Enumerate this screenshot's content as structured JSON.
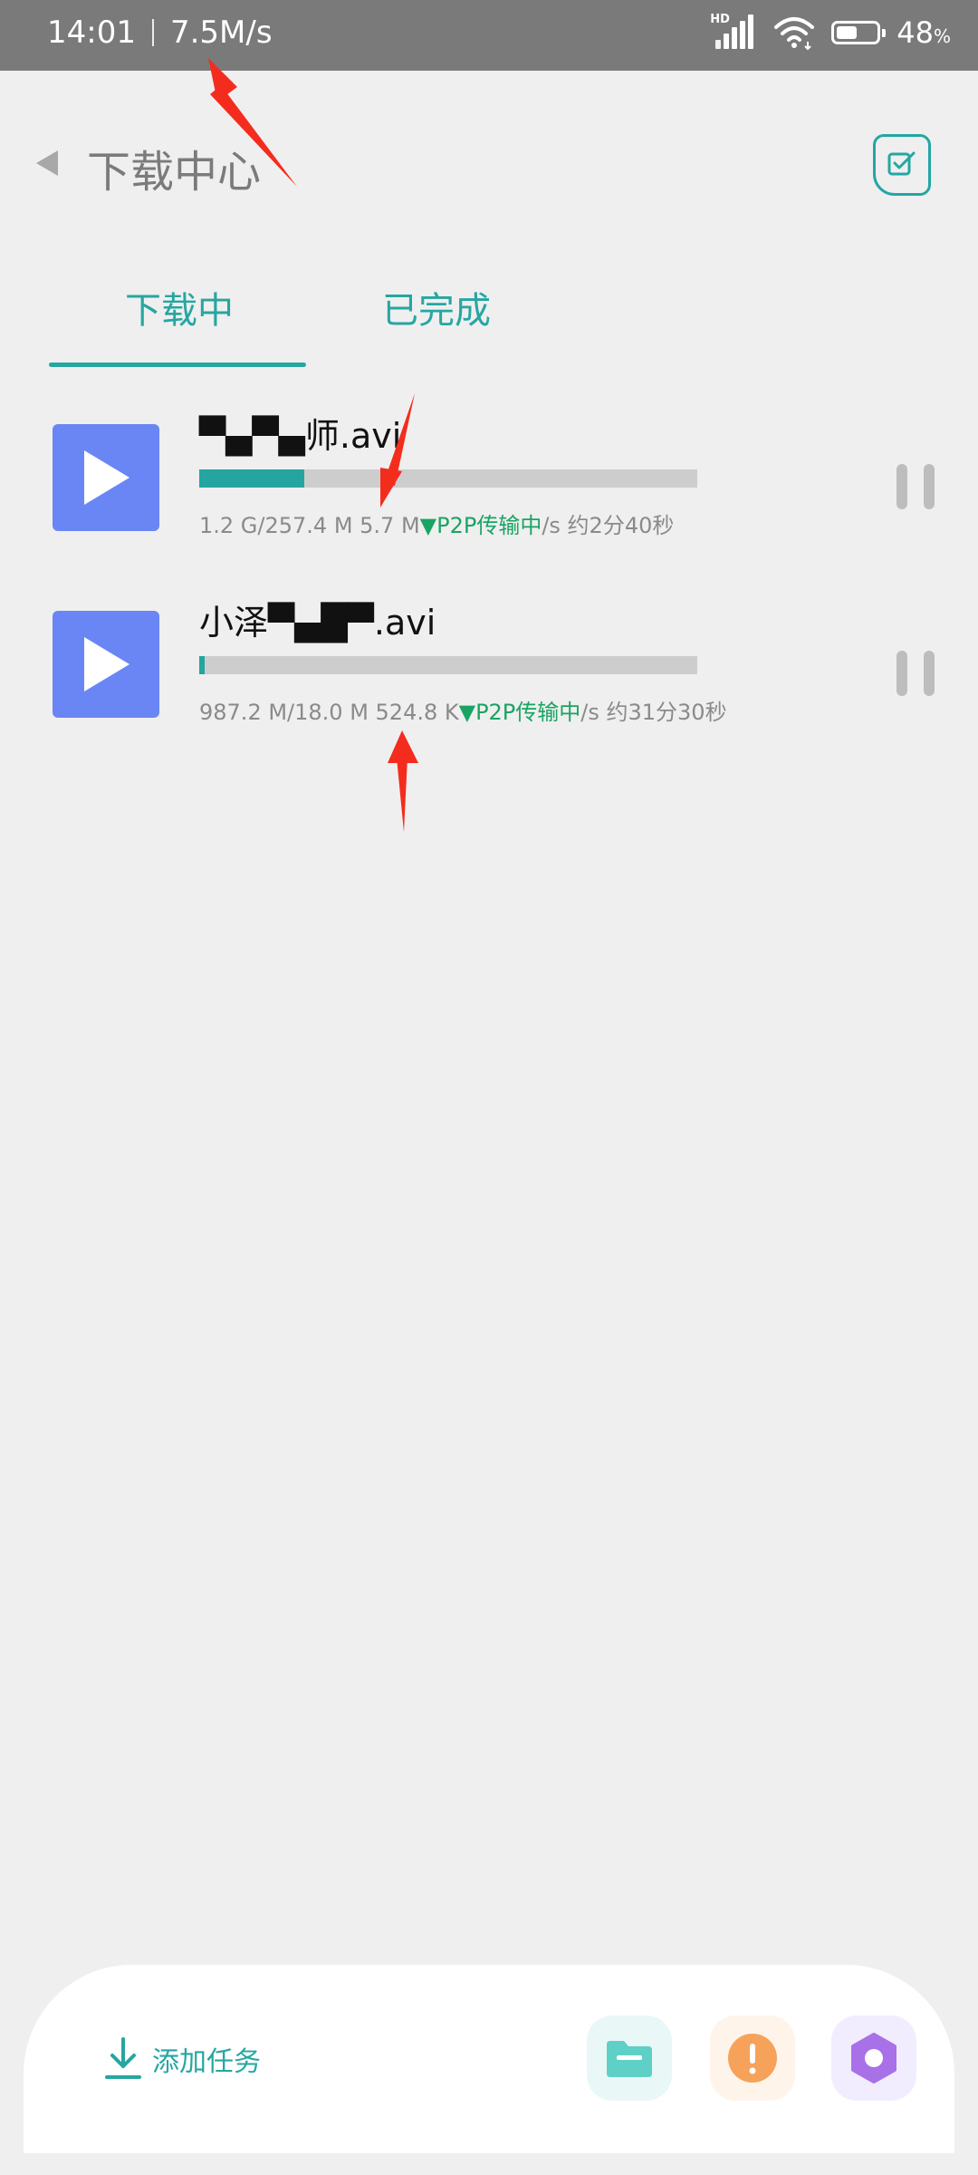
{
  "status_bar": {
    "time": "14:01",
    "net_speed": "7.5M/s",
    "battery_level": "48",
    "battery_unit": "%",
    "network_badge": "HD",
    "icons": [
      "signal-icon",
      "wifi-icon",
      "battery-icon"
    ]
  },
  "header": {
    "title": "下载中心",
    "back_icon": "back-arrow-icon",
    "edit_icon": "edit-checkbox-icon"
  },
  "tabs": [
    {
      "label": "下载中",
      "active": true
    },
    {
      "label": "已完成",
      "active": false
    }
  ],
  "downloads": [
    {
      "name": "▀▄▀▄师.avi",
      "progress": 0.21,
      "total": "1.2 G",
      "downloaded": "257.4 M",
      "speed": "5.7 M",
      "p2p_label": "▼P2P传输中",
      "speed_unit": "/s",
      "eta": "约2分40秒",
      "meta_prefix": "1.2 G/257.4 M 5.7 M",
      "meta_suffix": "/s 约2分40秒"
    },
    {
      "name": "小泽▀▄█▀.avi",
      "progress": 0.01,
      "total": "987.2 M",
      "downloaded": "18.0 M",
      "speed": "524.8 K",
      "p2p_label": "▼P2P传输中",
      "speed_unit": "/s",
      "eta": "约31分30秒",
      "meta_prefix": "987.2 M/18.0 M 524.8 K",
      "meta_suffix": "/s 约31分30秒"
    }
  ],
  "bottom_bar": {
    "add_task_label": "添加任务",
    "icons": [
      "download-icon",
      "folder-icon",
      "alert-icon",
      "settings-icon"
    ]
  },
  "colors": {
    "accent": "#27a6a1",
    "thumb": "#6a86f5",
    "p2p": "#1aa463",
    "annotation": "#f42c1e"
  }
}
